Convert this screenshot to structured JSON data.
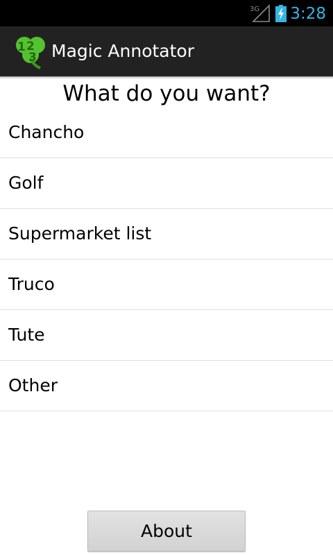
{
  "status_bar": {
    "network_label": "3G",
    "time": "3:28",
    "time_color": "#33b5e5",
    "icons": [
      "signal-3g-icon",
      "battery-charging-icon"
    ]
  },
  "action_bar": {
    "title": "Magic Annotator",
    "icon": "clover-123-app-icon",
    "background": "#222222"
  },
  "main": {
    "heading": "What do you want?",
    "items": [
      {
        "label": "Chancho"
      },
      {
        "label": "Golf"
      },
      {
        "label": "Supermarket list"
      },
      {
        "label": "Truco"
      },
      {
        "label": "Tute"
      },
      {
        "label": "Other"
      }
    ],
    "about_button": "About"
  }
}
